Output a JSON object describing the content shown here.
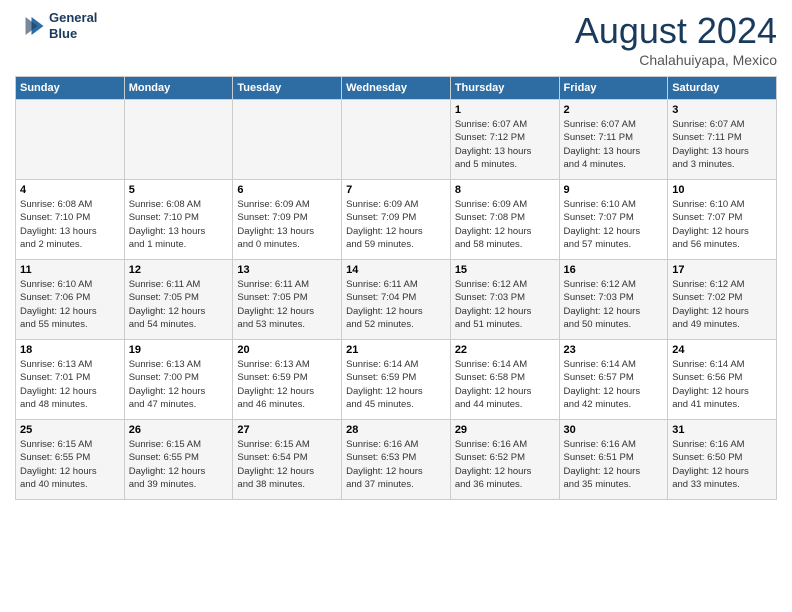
{
  "header": {
    "logo_line1": "General",
    "logo_line2": "Blue",
    "month": "August 2024",
    "location": "Chalahuiyapa, Mexico"
  },
  "weekdays": [
    "Sunday",
    "Monday",
    "Tuesday",
    "Wednesday",
    "Thursday",
    "Friday",
    "Saturday"
  ],
  "weeks": [
    [
      {
        "day": "",
        "info": ""
      },
      {
        "day": "",
        "info": ""
      },
      {
        "day": "",
        "info": ""
      },
      {
        "day": "",
        "info": ""
      },
      {
        "day": "1",
        "info": "Sunrise: 6:07 AM\nSunset: 7:12 PM\nDaylight: 13 hours\nand 5 minutes."
      },
      {
        "day": "2",
        "info": "Sunrise: 6:07 AM\nSunset: 7:11 PM\nDaylight: 13 hours\nand 4 minutes."
      },
      {
        "day": "3",
        "info": "Sunrise: 6:07 AM\nSunset: 7:11 PM\nDaylight: 13 hours\nand 3 minutes."
      }
    ],
    [
      {
        "day": "4",
        "info": "Sunrise: 6:08 AM\nSunset: 7:10 PM\nDaylight: 13 hours\nand 2 minutes."
      },
      {
        "day": "5",
        "info": "Sunrise: 6:08 AM\nSunset: 7:10 PM\nDaylight: 13 hours\nand 1 minute."
      },
      {
        "day": "6",
        "info": "Sunrise: 6:09 AM\nSunset: 7:09 PM\nDaylight: 13 hours\nand 0 minutes."
      },
      {
        "day": "7",
        "info": "Sunrise: 6:09 AM\nSunset: 7:09 PM\nDaylight: 12 hours\nand 59 minutes."
      },
      {
        "day": "8",
        "info": "Sunrise: 6:09 AM\nSunset: 7:08 PM\nDaylight: 12 hours\nand 58 minutes."
      },
      {
        "day": "9",
        "info": "Sunrise: 6:10 AM\nSunset: 7:07 PM\nDaylight: 12 hours\nand 57 minutes."
      },
      {
        "day": "10",
        "info": "Sunrise: 6:10 AM\nSunset: 7:07 PM\nDaylight: 12 hours\nand 56 minutes."
      }
    ],
    [
      {
        "day": "11",
        "info": "Sunrise: 6:10 AM\nSunset: 7:06 PM\nDaylight: 12 hours\nand 55 minutes."
      },
      {
        "day": "12",
        "info": "Sunrise: 6:11 AM\nSunset: 7:05 PM\nDaylight: 12 hours\nand 54 minutes."
      },
      {
        "day": "13",
        "info": "Sunrise: 6:11 AM\nSunset: 7:05 PM\nDaylight: 12 hours\nand 53 minutes."
      },
      {
        "day": "14",
        "info": "Sunrise: 6:11 AM\nSunset: 7:04 PM\nDaylight: 12 hours\nand 52 minutes."
      },
      {
        "day": "15",
        "info": "Sunrise: 6:12 AM\nSunset: 7:03 PM\nDaylight: 12 hours\nand 51 minutes."
      },
      {
        "day": "16",
        "info": "Sunrise: 6:12 AM\nSunset: 7:03 PM\nDaylight: 12 hours\nand 50 minutes."
      },
      {
        "day": "17",
        "info": "Sunrise: 6:12 AM\nSunset: 7:02 PM\nDaylight: 12 hours\nand 49 minutes."
      }
    ],
    [
      {
        "day": "18",
        "info": "Sunrise: 6:13 AM\nSunset: 7:01 PM\nDaylight: 12 hours\nand 48 minutes."
      },
      {
        "day": "19",
        "info": "Sunrise: 6:13 AM\nSunset: 7:00 PM\nDaylight: 12 hours\nand 47 minutes."
      },
      {
        "day": "20",
        "info": "Sunrise: 6:13 AM\nSunset: 6:59 PM\nDaylight: 12 hours\nand 46 minutes."
      },
      {
        "day": "21",
        "info": "Sunrise: 6:14 AM\nSunset: 6:59 PM\nDaylight: 12 hours\nand 45 minutes."
      },
      {
        "day": "22",
        "info": "Sunrise: 6:14 AM\nSunset: 6:58 PM\nDaylight: 12 hours\nand 44 minutes."
      },
      {
        "day": "23",
        "info": "Sunrise: 6:14 AM\nSunset: 6:57 PM\nDaylight: 12 hours\nand 42 minutes."
      },
      {
        "day": "24",
        "info": "Sunrise: 6:14 AM\nSunset: 6:56 PM\nDaylight: 12 hours\nand 41 minutes."
      }
    ],
    [
      {
        "day": "25",
        "info": "Sunrise: 6:15 AM\nSunset: 6:55 PM\nDaylight: 12 hours\nand 40 minutes."
      },
      {
        "day": "26",
        "info": "Sunrise: 6:15 AM\nSunset: 6:55 PM\nDaylight: 12 hours\nand 39 minutes."
      },
      {
        "day": "27",
        "info": "Sunrise: 6:15 AM\nSunset: 6:54 PM\nDaylight: 12 hours\nand 38 minutes."
      },
      {
        "day": "28",
        "info": "Sunrise: 6:16 AM\nSunset: 6:53 PM\nDaylight: 12 hours\nand 37 minutes."
      },
      {
        "day": "29",
        "info": "Sunrise: 6:16 AM\nSunset: 6:52 PM\nDaylight: 12 hours\nand 36 minutes."
      },
      {
        "day": "30",
        "info": "Sunrise: 6:16 AM\nSunset: 6:51 PM\nDaylight: 12 hours\nand 35 minutes."
      },
      {
        "day": "31",
        "info": "Sunrise: 6:16 AM\nSunset: 6:50 PM\nDaylight: 12 hours\nand 33 minutes."
      }
    ]
  ]
}
